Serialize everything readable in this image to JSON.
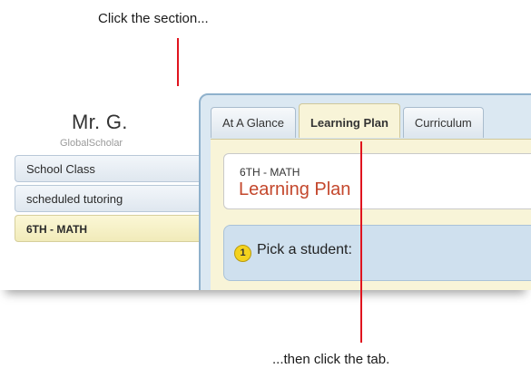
{
  "annotations": {
    "top": "Click the section...",
    "bottom": "...then click the tab."
  },
  "teacher": {
    "name": "Mr. G.",
    "brand": "GlobalScholar"
  },
  "sections": [
    {
      "label": "School Class",
      "active": false
    },
    {
      "label": "scheduled tutoring",
      "active": false
    },
    {
      "label": "6TH - MATH",
      "active": true
    }
  ],
  "tabs": [
    {
      "label": "At A Glance",
      "active": false
    },
    {
      "label": "Learning Plan",
      "active": true
    },
    {
      "label": "Curriculum",
      "active": false
    }
  ],
  "header": {
    "subject": "6TH - MATH",
    "title": "Learning Plan"
  },
  "step": {
    "number": "1",
    "text": "Pick a student:"
  },
  "colors": {
    "pointer": "#e0141e",
    "title_accent": "#c4472c",
    "active_highlight": "#f8f4d8",
    "panel_border": "#8fb1cc"
  }
}
